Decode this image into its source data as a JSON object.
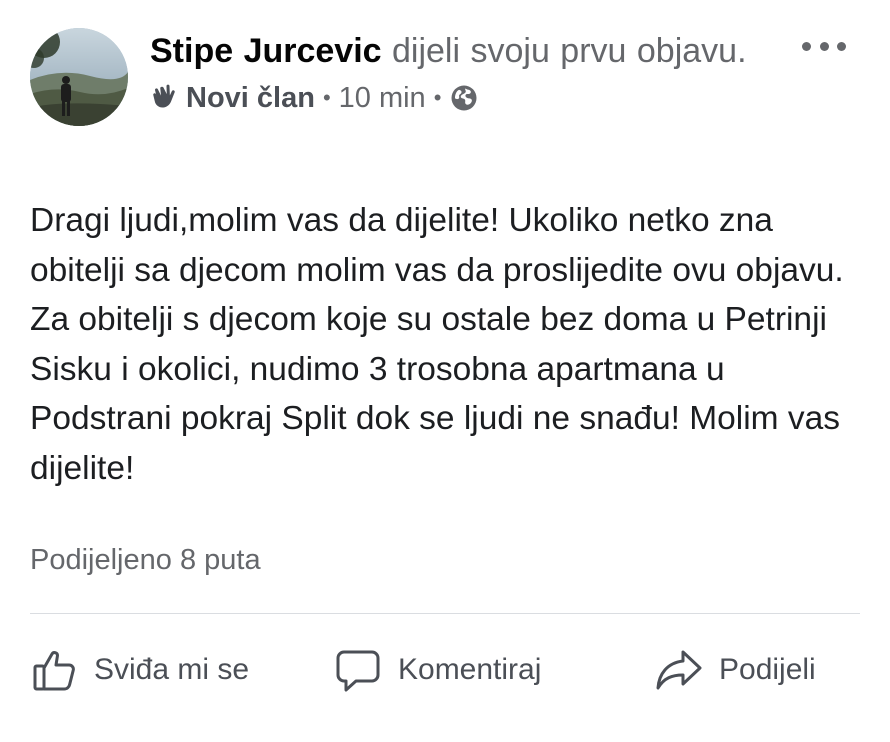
{
  "post": {
    "author": "Stipe Jurcevic",
    "action_text": " dijeli svoju prvu objavu.",
    "badge_label": "Novi član",
    "timestamp": "10 min",
    "separator": "•",
    "audience_icon": "globe-icon",
    "body": "Dragi ljudi,molim vas da dijelite! Ukoliko netko zna obitelji sa djecom molim vas da proslijedite ovu objavu. Za obitelji s djecom koje su ostale bez doma u Petrinji Sisku i okolici, nudimo 3 trosobna apartmana u Podstrani pokraj Split dok se ljudi ne snađu! Molim vas dijelite!",
    "share_count_text": "Podijeljeno 8 puta"
  },
  "actions": {
    "like_label": "Sviđa mi se",
    "comment_label": "Komentiraj",
    "share_label": "Podijeli"
  },
  "colors": {
    "text_primary": "#1c1e21",
    "text_secondary": "#65676b",
    "divider": "#dadde1"
  }
}
